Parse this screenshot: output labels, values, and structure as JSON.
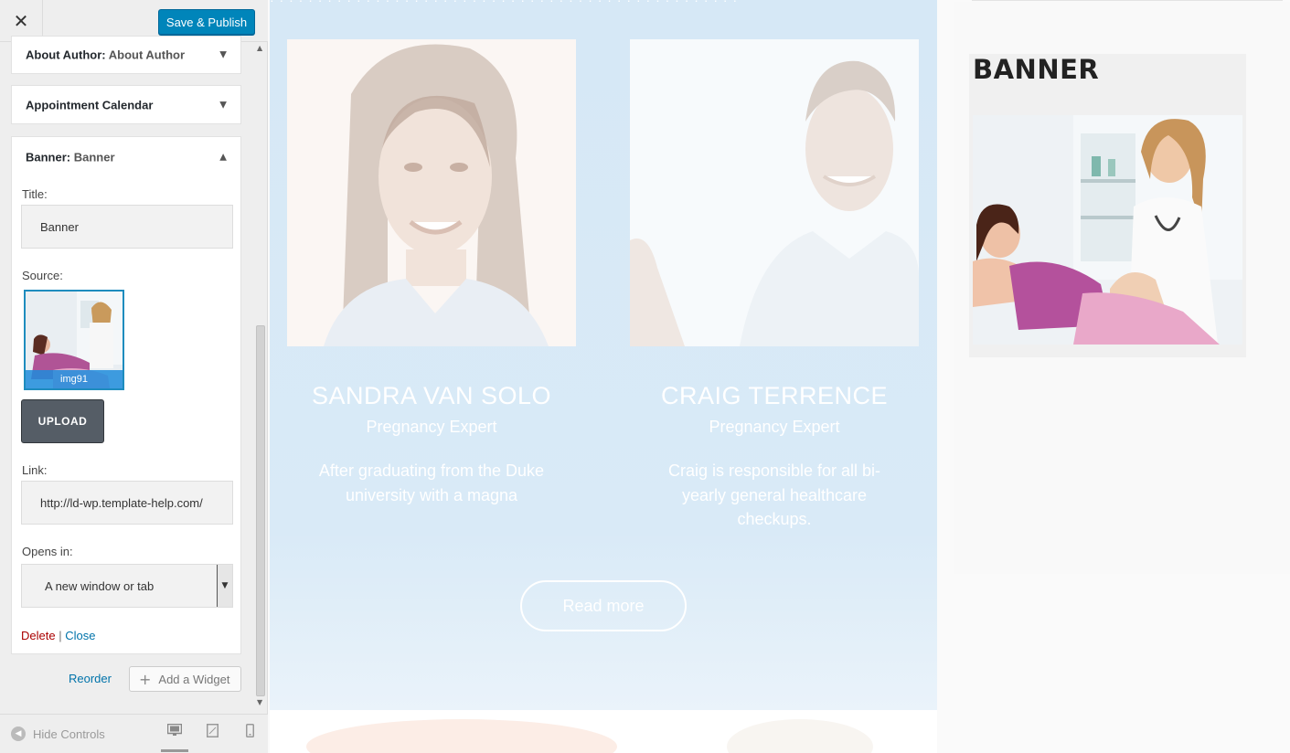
{
  "customizer": {
    "close_symbol": "✕",
    "save_label": "Save & Publish",
    "widgets": [
      {
        "name": "About Author",
        "sep": ": ",
        "title": "About Author"
      },
      {
        "name": "Appointment Calendar",
        "sep": "",
        "title": ""
      },
      {
        "name": "Banner",
        "sep": ": ",
        "title": "Banner"
      }
    ],
    "banner_form": {
      "title_label": "Title:",
      "title_value": "Banner",
      "source_label": "Source:",
      "source_filename": "img91",
      "upload_label": "UPLOAD",
      "link_label": "Link:",
      "link_value": "http://ld-wp.template-help.com/",
      "opens_label": "Opens in:",
      "opens_value": "A new window or tab",
      "delete_label": "Delete",
      "separator": "|",
      "close_label": "Close"
    },
    "reorder_label": "Reorder",
    "add_widget_label": "Add a Widget",
    "hide_controls_label": "Hide Controls",
    "devices": [
      "desktop",
      "tablet",
      "mobile"
    ],
    "active_device": "desktop",
    "colors": {
      "primary": "#0085ba",
      "delete": "#aa0000",
      "link": "#0073aa"
    }
  },
  "preview": {
    "doctors": [
      {
        "name": "SANDRA VAN SOLO",
        "role": "Pregnancy Expert",
        "description": "After graduating from the Duke university with a magna"
      },
      {
        "name": "CRAIG TERRENCE",
        "role": "Pregnancy Expert",
        "description": "Craig is responsible for all bi-yearly general healthcare checkups."
      }
    ],
    "read_more_label": "Read more",
    "banner_title": "BANNER",
    "colors": {
      "team_bg": "#d6e8f6",
      "text": "#ffffff"
    }
  }
}
